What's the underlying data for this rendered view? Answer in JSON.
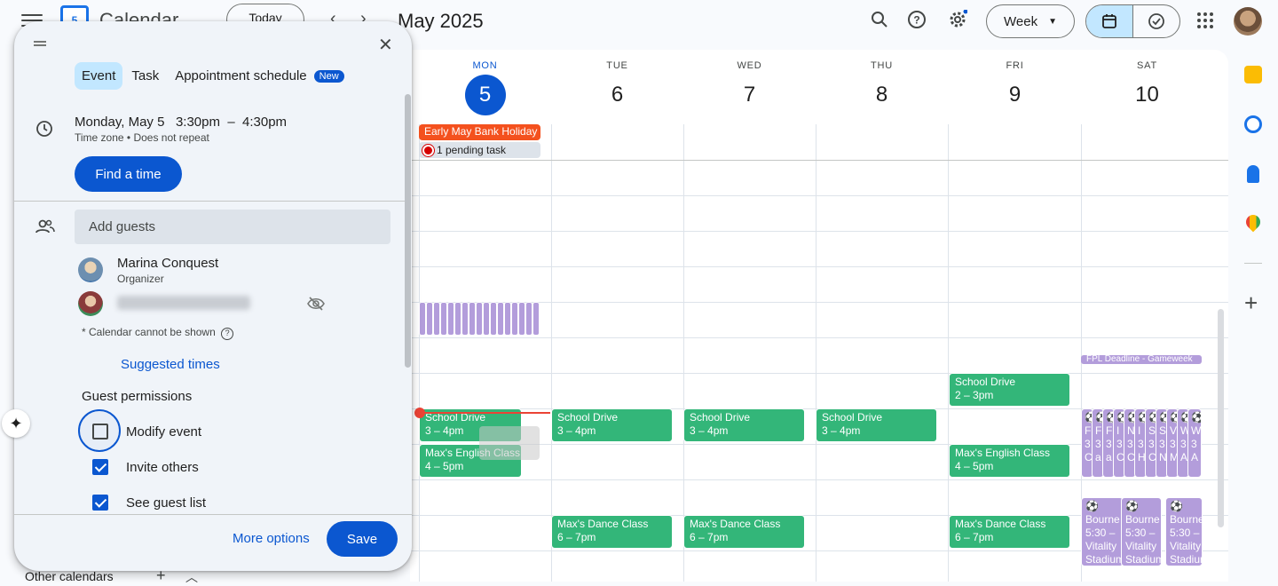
{
  "header": {
    "app_title": "Calendar",
    "logo_text": "5",
    "today_label": "Today",
    "month_title": "May 2025",
    "view_label": "Week"
  },
  "days": [
    {
      "dow": "MON",
      "date": "5",
      "today": true
    },
    {
      "dow": "TUE",
      "date": "6"
    },
    {
      "dow": "WED",
      "date": "7"
    },
    {
      "dow": "THU",
      "date": "8"
    },
    {
      "dow": "FRI",
      "date": "9"
    },
    {
      "dow": "SAT",
      "date": "10"
    }
  ],
  "allday": {
    "holiday": "Early May Bank Holiday",
    "pending": "1 pending task"
  },
  "events": {
    "school_drive": "School Drive",
    "school_time_mon": "3 – 4pm",
    "school_time_fri": "2 – 3pm",
    "english": "Max's English Class",
    "english_time": "4 – 5pm",
    "dance": "Max's Dance Class",
    "dance_time": "6 – 7pm",
    "fpl": "FPL Deadline - Gameweek",
    "bourne": "Bourne",
    "bourne_time": "5:30 –",
    "bourne_loc": "Vitality",
    "bourne_loc2": "Stadium"
  },
  "dialog": {
    "tabs": [
      "Event",
      "Task",
      "Appointment schedule"
    ],
    "new_badge": "New",
    "date": "Monday, May 5",
    "time": "3:30pm  –  4:30pm",
    "timezone": "Time zone • Does not repeat",
    "find_time": "Find a time",
    "add_guests": "Add guests",
    "organizer_name": "Marina Conquest",
    "organizer_role": "Organizer",
    "calendar_note": "* Calendar cannot be shown",
    "suggested_times": "Suggested times",
    "guest_permissions": "Guest permissions",
    "perm_modify": "Modify event",
    "perm_invite": "Invite others",
    "perm_seelist": "See guest list",
    "more_options": "More options",
    "save": "Save"
  },
  "sidebar": {
    "other_calendars": "Other calendars"
  },
  "colors": {
    "accent": "#0b57d0",
    "event_green": "#33b679",
    "holiday_orange": "#f4511e",
    "lavender": "#b39ddb"
  }
}
